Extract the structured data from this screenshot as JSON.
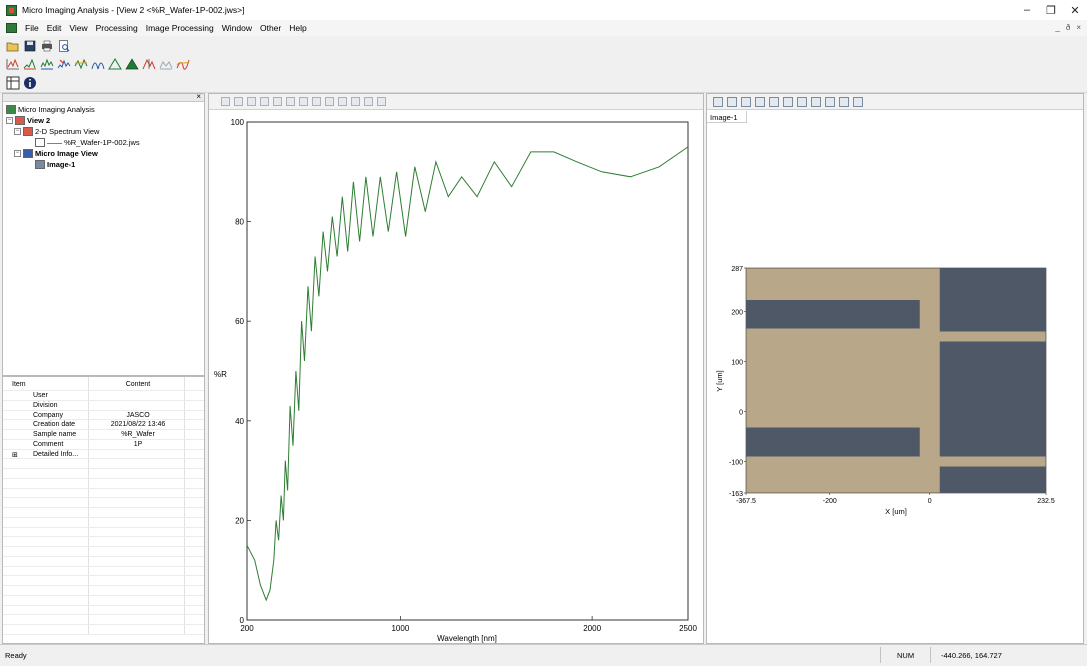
{
  "window": {
    "title": "Micro Imaging Analysis - [View 2 <%R_Wafer-1P-002.jws>]",
    "controls": [
      "–",
      "❐",
      "✕"
    ],
    "mdi_controls": [
      "_",
      "ð",
      "×"
    ]
  },
  "menu": [
    "File",
    "Edit",
    "View",
    "Processing",
    "Image Processing",
    "Window",
    "Other",
    "Help"
  ],
  "tree": {
    "root": "Micro Imaging Analysis",
    "view": "View 2",
    "spectrum_view": "2-D Spectrum View",
    "spectrum_file": "—— %R_Wafer-1P-002.jws",
    "micro_image_view": "Micro Image View",
    "image": "Image-1"
  },
  "properties": {
    "headers": {
      "item": "Item",
      "content": "Content"
    },
    "rows": [
      {
        "item": "User",
        "content": ""
      },
      {
        "item": "Division",
        "content": ""
      },
      {
        "item": "Company",
        "content": "JASCO"
      },
      {
        "item": "Creation date",
        "content": "2021/08/22 13:46"
      },
      {
        "item": "Sample name",
        "content": "%R_Wafer"
      },
      {
        "item": "Comment",
        "content": "1P"
      },
      {
        "item": "Detailed Info...",
        "content": "",
        "expandable": true
      }
    ]
  },
  "spectrum": {
    "chart_data": {
      "type": "line",
      "xlabel": "Wavelength [nm]",
      "ylabel": "%R",
      "xlim": [
        200,
        2500
      ],
      "ylim": [
        0,
        100
      ],
      "xticks": [
        200,
        1000,
        2000,
        2500
      ],
      "yticks": [
        0,
        20,
        40,
        60,
        80,
        100
      ],
      "line_color": "#2e7d32",
      "series": [
        {
          "x": [
            200,
            240,
            270,
            300,
            320,
            340,
            352,
            365,
            378,
            390,
            400,
            412,
            425,
            440,
            455,
            470,
            485,
            500,
            518,
            536,
            555,
            575,
            597,
            620,
            645,
            670,
            697,
            725,
            755,
            787,
            820,
            857,
            895,
            937,
            980,
            1027,
            1075,
            1130,
            1185,
            1250,
            1320,
            1400,
            1490,
            1580,
            1680,
            1800,
            1920,
            2050,
            2200,
            2350,
            2500
          ],
          "y": [
            15,
            12,
            7,
            4,
            6,
            12,
            20,
            16,
            25,
            20,
            32,
            26,
            43,
            35,
            50,
            42,
            60,
            52,
            67,
            58,
            73,
            65,
            78,
            70,
            81,
            73,
            85,
            74,
            88,
            76,
            89,
            77,
            89,
            78,
            90,
            77,
            91,
            82,
            92,
            85,
            89,
            85,
            92,
            87,
            94,
            94,
            92,
            90,
            89,
            91,
            95
          ]
        }
      ]
    }
  },
  "image_view": {
    "tab": "Image-1",
    "xlabel": "X [um]",
    "ylabel": "Y [um]",
    "xticks": [
      "-367.5",
      "-200",
      "0",
      "232.5"
    ],
    "yticks": [
      "287",
      "200",
      "100",
      "0",
      "-100",
      "-163"
    ],
    "xlim": [
      -367.5,
      232.5
    ],
    "ylim": [
      -163,
      287
    ],
    "colors": {
      "background": "#b8a889",
      "pad": "#4e5866"
    }
  },
  "status": {
    "text": "Ready",
    "num": "NUM",
    "coords": "-440.266, 164.727"
  },
  "icons": {
    "toolbar1": [
      "open-icon",
      "save-icon",
      "print-icon",
      "print-preview-icon"
    ],
    "toolbar2": [
      "spectrum-icon",
      "peak-icon",
      "baseline-icon",
      "smoothing-icon",
      "derivative-icon",
      "curve-icon",
      "peak-find-icon",
      "peak-area-icon",
      "deconvolution-icon",
      "overlay-icon",
      "calculation-icon"
    ],
    "toolbar3": [
      "layout-icon",
      "info-icon"
    ]
  }
}
